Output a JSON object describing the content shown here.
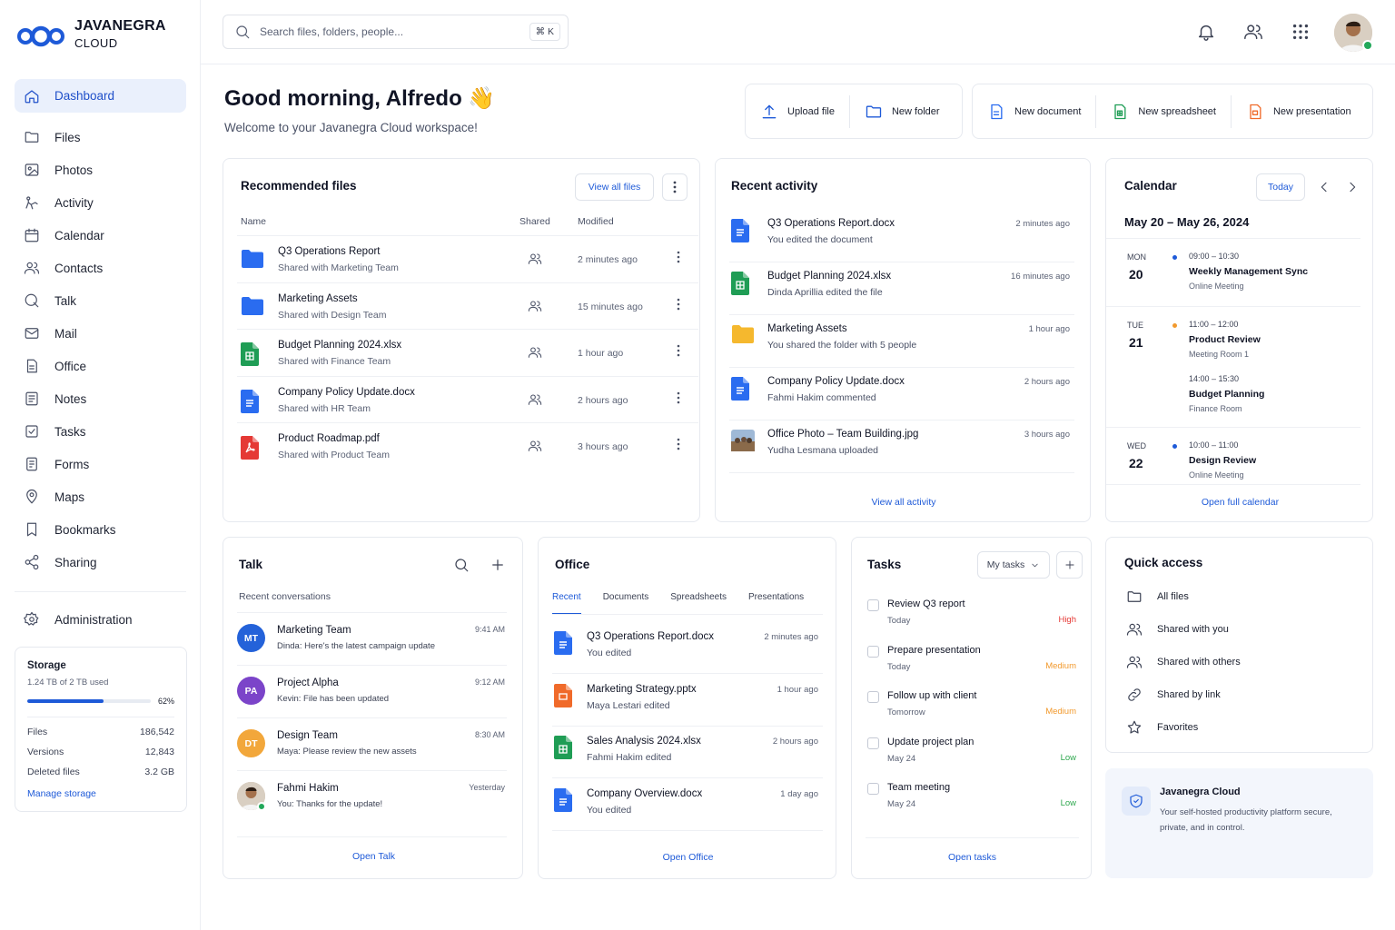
{
  "app": {
    "name_line1": "JAVANEGRA",
    "name_line2": "CLOUD"
  },
  "sidebar": {
    "items": [
      {
        "label": "Dashboard",
        "icon": "home-icon",
        "active": true
      },
      {
        "label": "Files",
        "icon": "folder-icon"
      },
      {
        "label": "Photos",
        "icon": "image-icon"
      },
      {
        "label": "Activity",
        "icon": "activity-icon"
      },
      {
        "label": "Calendar",
        "icon": "calendar-icon"
      },
      {
        "label": "Contacts",
        "icon": "users-icon"
      },
      {
        "label": "Talk",
        "icon": "chat-icon"
      },
      {
        "label": "Mail",
        "icon": "mail-icon"
      },
      {
        "label": "Office",
        "icon": "document-icon"
      },
      {
        "label": "Notes",
        "icon": "notes-icon"
      },
      {
        "label": "Tasks",
        "icon": "checkbox-icon"
      },
      {
        "label": "Forms",
        "icon": "form-icon"
      },
      {
        "label": "Maps",
        "icon": "map-pin-icon"
      },
      {
        "label": "Bookmarks",
        "icon": "bookmark-icon"
      },
      {
        "label": "Sharing",
        "icon": "share-icon"
      }
    ],
    "admin_label": "Administration"
  },
  "storage": {
    "title": "Storage",
    "usage": "1.24 TB of 2 TB used",
    "percent_label": "62%",
    "percent": 62,
    "rows": [
      {
        "label": "Files",
        "value": "186,542"
      },
      {
        "label": "Versions",
        "value": "12,843"
      },
      {
        "label": "Deleted files",
        "value": "3.2 GB"
      }
    ],
    "manage_label": "Manage storage"
  },
  "search": {
    "placeholder": "Search files, folders, people...",
    "shortcut": "⌘ K"
  },
  "header": {
    "greeting": "Good morning, Alfredo 👋",
    "welcome": "Welcome to your Javanegra Cloud workspace!"
  },
  "quick_actions": {
    "upload": "Upload file",
    "new_folder": "New folder",
    "new_document": "New document",
    "new_spreadsheet": "New spreadsheet",
    "new_presentation": "New presentation"
  },
  "recommended": {
    "title": "Recommended files",
    "view_all": "View all files",
    "col_name": "Name",
    "col_shared": "Shared",
    "col_modified": "Modified",
    "files": [
      {
        "name": "Q3 Operations Report",
        "shared": "Shared with Marketing Team",
        "modified": "2 minutes ago",
        "type": "folder"
      },
      {
        "name": "Marketing Assets",
        "shared": "Shared with Design Team",
        "modified": "15 minutes ago",
        "type": "folder"
      },
      {
        "name": "Budget Planning 2024.xlsx",
        "shared": "Shared with Finance Team",
        "modified": "1 hour ago",
        "type": "sheet"
      },
      {
        "name": "Company Policy Update.docx",
        "shared": "Shared with HR Team",
        "modified": "2 hours ago",
        "type": "doc"
      },
      {
        "name": "Product Roadmap.pdf",
        "shared": "Shared with Product Team",
        "modified": "3 hours ago",
        "type": "pdf"
      }
    ]
  },
  "activity": {
    "title": "Recent activity",
    "items": [
      {
        "name": "Q3 Operations Report.docx",
        "desc": "You edited the document",
        "time": "2 minutes ago",
        "type": "doc"
      },
      {
        "name": "Budget Planning 2024.xlsx",
        "desc": "Dinda Aprillia edited the file",
        "time": "16 minutes ago",
        "type": "sheet"
      },
      {
        "name": "Marketing Assets",
        "desc": "You shared the folder with 5 people",
        "time": "1 hour ago",
        "type": "yfolder"
      },
      {
        "name": "Company Policy Update.docx",
        "desc": "Fahmi Hakim commented",
        "time": "2 hours ago",
        "type": "doc"
      },
      {
        "name": "Office Photo – Team Building.jpg",
        "desc": "Yudha Lesmana uploaded",
        "time": "3 hours ago",
        "type": "photo"
      }
    ],
    "view_all": "View all activity"
  },
  "calendar": {
    "title": "Calendar",
    "today": "Today",
    "range": "May 20 – May 26, 2024",
    "days": [
      {
        "dow": "MON",
        "num": "20",
        "events": [
          {
            "time": "09:00 – 10:30",
            "title": "Weekly Management Sync",
            "loc": "Online Meeting",
            "color": "#1e5ad8"
          }
        ]
      },
      {
        "dow": "TUE",
        "num": "21",
        "events": [
          {
            "time": "11:00 – 12:00",
            "title": "Product Review",
            "loc": "Meeting Room 1",
            "color": "#f29a2e"
          },
          {
            "time": "14:00 – 15:30",
            "title": "Budget Planning",
            "loc": "Finance Room",
            "color": ""
          }
        ]
      },
      {
        "dow": "WED",
        "num": "22",
        "events": [
          {
            "time": "10:00 – 11:00",
            "title": "Design Review",
            "loc": "Online Meeting",
            "color": "#1e5ad8"
          }
        ]
      }
    ],
    "open_full": "Open full calendar"
  },
  "talk": {
    "title": "Talk",
    "subtitle": "Recent conversations",
    "conversations": [
      {
        "initials": "MT",
        "name": "Marketing Team",
        "msg": "Dinda: Here's the latest campaign update",
        "time": "9:41 AM",
        "color": "#2462d9"
      },
      {
        "initials": "PA",
        "name": "Project Alpha",
        "msg": "Kevin: File has been updated",
        "time": "9:12 AM",
        "color": "#7b44c9"
      },
      {
        "initials": "DT",
        "name": "Design Team",
        "msg": "Maya: Please review the new assets",
        "time": "8:30 AM",
        "color": "#f2a73b"
      },
      {
        "initials": "",
        "name": "Fahmi Hakim",
        "msg": "You: Thanks for the update!",
        "time": "Yesterday",
        "color": "#c9b49c"
      }
    ],
    "open": "Open Talk"
  },
  "office": {
    "title": "Office",
    "tabs": [
      "Recent",
      "Documents",
      "Spreadsheets",
      "Presentations"
    ],
    "files": [
      {
        "name": "Q3 Operations Report.docx",
        "desc": "You edited",
        "time": "2 minutes ago",
        "type": "doc"
      },
      {
        "name": "Marketing Strategy.pptx",
        "desc": "Maya Lestari edited",
        "time": "1 hour ago",
        "type": "slide"
      },
      {
        "name": "Sales Analysis 2024.xlsx",
        "desc": "Fahmi Hakim edited",
        "time": "2 hours ago",
        "type": "sheet"
      },
      {
        "name": "Company Overview.docx",
        "desc": "You edited",
        "time": "1 day ago",
        "type": "doc"
      }
    ],
    "open": "Open Office"
  },
  "tasks": {
    "title": "Tasks",
    "filter": "My tasks",
    "items": [
      {
        "name": "Review Q3 report",
        "due": "Today",
        "priority": "High",
        "color": "#e53935"
      },
      {
        "name": "Prepare presentation",
        "due": "Today",
        "priority": "Medium",
        "color": "#f29a2e"
      },
      {
        "name": "Follow up with client",
        "due": "Tomorrow",
        "priority": "Medium",
        "color": "#f29a2e"
      },
      {
        "name": "Update project plan",
        "due": "May 24",
        "priority": "Low",
        "color": "#2fa84f"
      },
      {
        "name": "Team meeting",
        "due": "May 24",
        "priority": "Low",
        "color": "#2fa84f"
      }
    ],
    "open": "Open tasks"
  },
  "quick_access": {
    "title": "Quick access",
    "items": [
      {
        "label": "All files",
        "icon": "folder-icon"
      },
      {
        "label": "Shared with you",
        "icon": "users-icon"
      },
      {
        "label": "Shared with others",
        "icon": "users-icon"
      },
      {
        "label": "Shared by link",
        "icon": "link-icon"
      },
      {
        "label": "Favorites",
        "icon": "star-icon"
      }
    ]
  },
  "promo": {
    "title": "Javanegra Cloud",
    "desc": "Your self-hosted productivity platform secure, private, and in control."
  },
  "colors": {
    "accent": "#1e5ad8",
    "doc": "#2a6cf0",
    "sheet": "#1f9d55",
    "pdf": "#e53935",
    "slide": "#f06a2a"
  }
}
